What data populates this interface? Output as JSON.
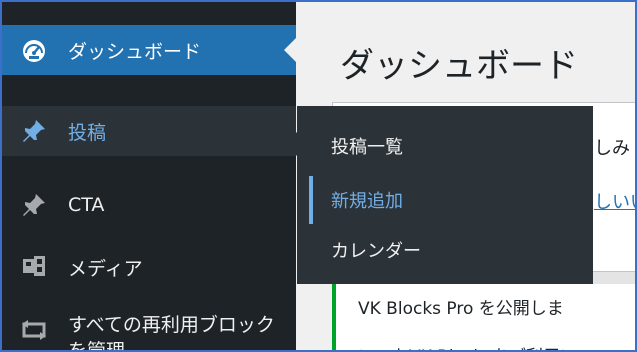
{
  "sidebar": {
    "items": [
      {
        "label": "ダッシュボード",
        "icon": "dashboard-gauge-icon"
      },
      {
        "label": "投稿",
        "icon": "pin-icon"
      },
      {
        "label": "CTA",
        "icon": "pin-icon"
      },
      {
        "label": "メディア",
        "icon": "media-icon"
      },
      {
        "label": "すべての再利用ブロックを管理",
        "icon": "reusable-blocks-icon"
      }
    ]
  },
  "flyout": {
    "items": [
      {
        "label": "投稿一覧"
      },
      {
        "label": "新規追加"
      },
      {
        "label": "カレンダー"
      }
    ]
  },
  "main": {
    "title": "ダッシュボード",
    "welcome_text": "しみ",
    "welcome_link": "しいい",
    "notice_title": "VK Blocks Pro を公開しま",
    "notice_sub": "いつもVK Blocksをご利用い"
  },
  "colors": {
    "sidebar_bg": "#1d2327",
    "active_bg": "#2271b1",
    "flyout_bg": "#2c3338",
    "highlight": "#72aee6",
    "notice_border": "#00a32a"
  }
}
